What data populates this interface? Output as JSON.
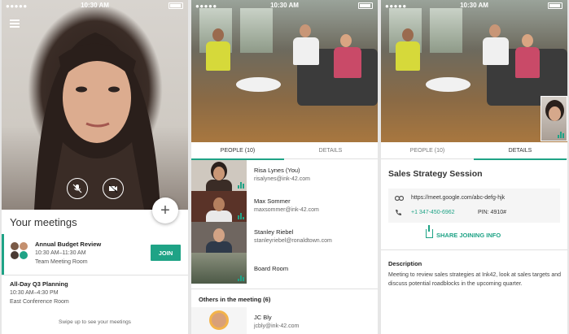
{
  "status": {
    "signal": "●●●●● ",
    "time": "10:30 AM"
  },
  "home": {
    "section_title": "Your meetings",
    "meetings": [
      {
        "title": "Annual Budget Review",
        "time": "10:30 AM–11:30 AM",
        "room": "Team Meeting Room",
        "action": "JOIN"
      },
      {
        "title": "All-Day Q3 Planning",
        "time": "10:30 AM–4:30 PM",
        "room": "East Conference Room"
      }
    ],
    "fab_label": "+",
    "footer": "Swipe up to see your meetings"
  },
  "tabs": {
    "people": "PEOPLE (10)",
    "details": "DETAILS"
  },
  "people": [
    {
      "name": "Risa Lynes (You)",
      "email": "risalynes@ink-42.com"
    },
    {
      "name": "Max Sommer",
      "email": "maxsommer@ink-42.com"
    },
    {
      "name": "Stanley Riebel",
      "email": "stanleyriebel@ronaldtown.com"
    },
    {
      "name": "Board Room",
      "email": ""
    }
  ],
  "others": {
    "label": "Others in the meeting  (6)",
    "first": {
      "name": "JC Bly",
      "email": "jcbly@ink-42.com"
    }
  },
  "details": {
    "title": "Sales Strategy Session",
    "link": "https://meet.google.com/abc-defg-hjk",
    "phone": "+1 347-450-6962",
    "pin": "PIN: 4910#",
    "share": "SHARE JOINING INFO",
    "desc_heading": "Description",
    "description": "Meeting to review sales strategies at Ink42, look at sales targets and discuss potential roadblocks in the upcoming quarter."
  },
  "colors": {
    "accent": "#1fa386"
  }
}
